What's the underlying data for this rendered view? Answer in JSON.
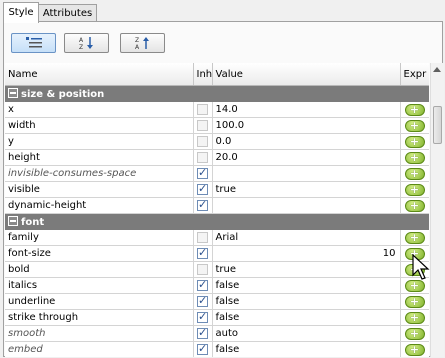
{
  "tabs": [
    "Style",
    "Attributes"
  ],
  "toolbar": {
    "buttons": [
      "categorized-view",
      "sort-ascending",
      "sort-descending"
    ]
  },
  "columns": {
    "name": "Name",
    "inh": "Inh",
    "value": "Value",
    "expr": "Expr"
  },
  "rows": [
    {
      "type": "section",
      "name": "size & position"
    },
    {
      "type": "prop",
      "name": "x",
      "inh": false,
      "value": "14.0",
      "italic": false
    },
    {
      "type": "prop",
      "name": "width",
      "inh": false,
      "value": "100.0",
      "italic": false
    },
    {
      "type": "prop",
      "name": "y",
      "inh": false,
      "value": "0.0",
      "italic": false
    },
    {
      "type": "prop",
      "name": "height",
      "inh": false,
      "value": "20.0",
      "italic": false
    },
    {
      "type": "prop",
      "name": "invisible-consumes-space",
      "inh": true,
      "value": "",
      "italic": true
    },
    {
      "type": "prop",
      "name": "visible",
      "inh": true,
      "value": "true",
      "italic": false
    },
    {
      "type": "prop",
      "name": "dynamic-height",
      "inh": true,
      "value": "",
      "italic": false
    },
    {
      "type": "section",
      "name": "font"
    },
    {
      "type": "prop",
      "name": "family",
      "inh": false,
      "value": "Arial",
      "italic": false
    },
    {
      "type": "prop",
      "name": "font-size",
      "inh": true,
      "value": "10",
      "italic": false,
      "numeric": true
    },
    {
      "type": "prop",
      "name": "bold",
      "inh": false,
      "value": "true",
      "italic": false
    },
    {
      "type": "prop",
      "name": "italics",
      "inh": true,
      "value": "false",
      "italic": false
    },
    {
      "type": "prop",
      "name": "underline",
      "inh": true,
      "value": "false",
      "italic": false
    },
    {
      "type": "prop",
      "name": "strike through",
      "inh": true,
      "value": "false",
      "italic": false
    },
    {
      "type": "prop",
      "name": "smooth",
      "inh": true,
      "value": "auto",
      "italic": true
    },
    {
      "type": "prop",
      "name": "embed",
      "inh": true,
      "value": "false",
      "italic": true
    }
  ]
}
